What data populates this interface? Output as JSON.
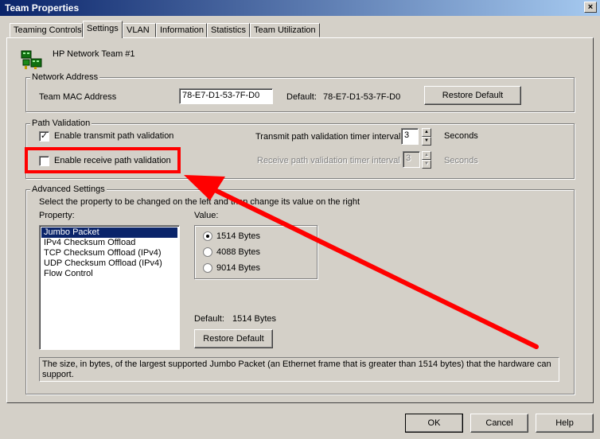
{
  "window": {
    "title": "Team Properties",
    "close_glyph": "×"
  },
  "tabs": [
    {
      "label": "Teaming Controls"
    },
    {
      "label": "Settings",
      "active": true
    },
    {
      "label": "VLAN"
    },
    {
      "label": "Information"
    },
    {
      "label": "Statistics"
    },
    {
      "label": "Team Utilization"
    }
  ],
  "team_name": "HP Network Team #1",
  "network_address": {
    "group_label": "Network Address",
    "mac_label": "Team MAC Address",
    "mac_value": "78-E7-D1-53-7F-D0",
    "default_label": "Default:",
    "default_value": "78-E7-D1-53-7F-D0",
    "restore_label": "Restore Default"
  },
  "path_validation": {
    "group_label": "Path Validation",
    "transmit_label": "Enable transmit path validation",
    "transmit_checked": true,
    "transmit_timer_label": "Transmit path validation timer interval",
    "transmit_timer_value": "3",
    "transmit_unit": "Seconds",
    "receive_label": "Enable receive path validation",
    "receive_checked": false,
    "receive_timer_label": "Receive path validation timer interval",
    "receive_timer_value": "3",
    "receive_unit": "Seconds"
  },
  "advanced": {
    "group_label": "Advanced Settings",
    "instruction": "Select the property to be changed on the left and then change its value on the right",
    "property_label": "Property:",
    "value_label": "Value:",
    "properties": [
      {
        "label": "Jumbo Packet",
        "selected": true
      },
      {
        "label": "IPv4 Checksum Offload"
      },
      {
        "label": "TCP Checksum Offload (IPv4)"
      },
      {
        "label": "UDP Checksum Offload (IPv4)"
      },
      {
        "label": "Flow Control"
      }
    ],
    "options": [
      {
        "label": "1514 Bytes",
        "selected": true
      },
      {
        "label": "4088 Bytes"
      },
      {
        "label": "9014 Bytes"
      }
    ],
    "default_label": "Default:",
    "default_value": "1514 Bytes",
    "restore_label": "Restore Default",
    "description": "The size, in bytes, of the largest supported Jumbo Packet (an Ethernet frame that is greater than 1514 bytes) that the hardware can support."
  },
  "footer": {
    "ok_label": "OK",
    "cancel_label": "Cancel",
    "help_label": "Help"
  },
  "annotation_colors": {
    "highlight": "#ff0000",
    "arrow": "#ff0000"
  },
  "icons": {
    "team": "network-team-icon",
    "check": "✓",
    "spin_up": "▲",
    "spin_down": "▼"
  }
}
